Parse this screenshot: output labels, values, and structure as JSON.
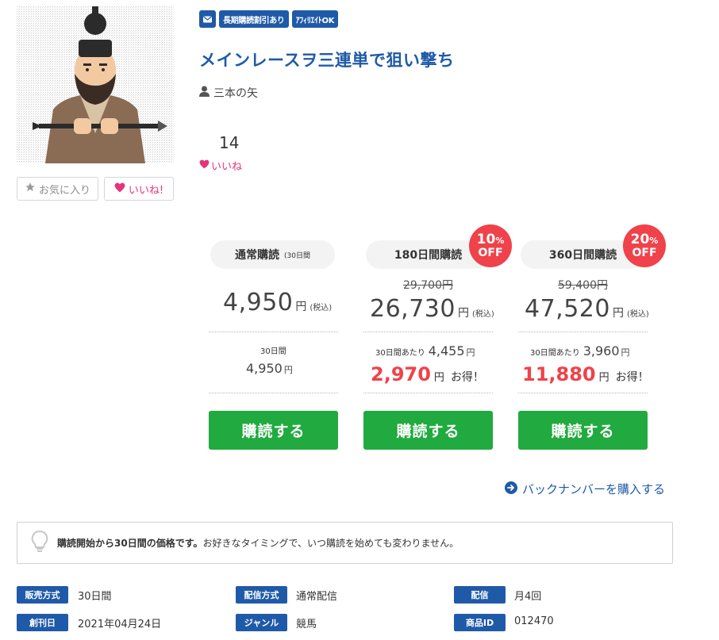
{
  "product": {
    "badges": [
      "長期購読割引あり",
      "ｱﾌｨﾘｴｲﾄOK"
    ],
    "title": "メインレースヲ三連単で狙い撃ち",
    "author": "三本の矢",
    "like_count": "14",
    "like_label": "いいね",
    "fav_button": "お気に入り",
    "like_button": "いいね!"
  },
  "plans": [
    {
      "name": "通常購読",
      "name_note": "(30日間",
      "price": "4,950",
      "yen": "円",
      "tax": "(税込)",
      "per30_label": "30日間",
      "per30_price": "4,950",
      "per30_yen": "円",
      "buy_label": "購読する"
    },
    {
      "name": "180日間購読",
      "off_pct": "10",
      "off_label": "OFF",
      "original_price": "29,700円",
      "price": "26,730",
      "yen": "円",
      "tax": "(税込)",
      "per30_label": "30日間あたり",
      "per30_price": "4,455",
      "per30_yen": "円",
      "save_amount": "2,970",
      "save_yen": "円",
      "save_label": "お得！",
      "buy_label": "購読する"
    },
    {
      "name": "360日間購読",
      "off_pct": "20",
      "off_label": "OFF",
      "original_price": "59,400円",
      "price": "47,520",
      "yen": "円",
      "tax": "(税込)",
      "per30_label": "30日間あたり",
      "per30_price": "3,960",
      "per30_yen": "円",
      "save_amount": "11,880",
      "save_yen": "円",
      "save_label": "お得！",
      "buy_label": "購読する"
    }
  ],
  "backnumber_link": "バックナンバーを購入する",
  "notice": {
    "bold": "購読開始から30日間の価格です。",
    "text": "お好きなタイミングで、いつ購読を始めても変わりません。"
  },
  "meta": [
    {
      "tag": "販売方式",
      "value": "30日間"
    },
    {
      "tag": "配信方式",
      "value": "通常配信"
    },
    {
      "tag": "配信",
      "value": "月4回"
    },
    {
      "tag": "創刊日",
      "value": "2021年04月24日"
    },
    {
      "tag": "ジャンル",
      "value": "競馬"
    },
    {
      "tag": "商品ID",
      "value": "012470"
    }
  ],
  "colors": {
    "brand_blue": "#1f5aa8",
    "buy_green": "#21aa3f",
    "sale_red": "#f0424a",
    "like_pink": "#e8337a"
  }
}
